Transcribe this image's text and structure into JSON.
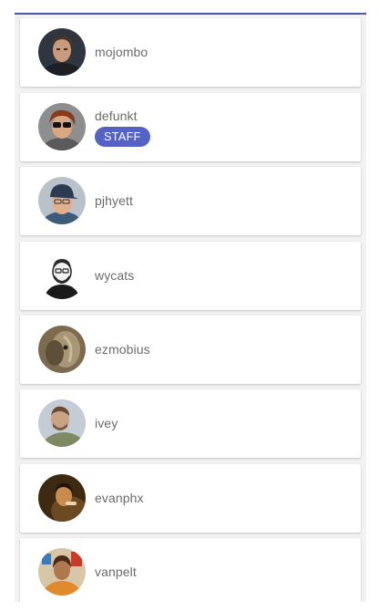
{
  "users": [
    {
      "login": "mojombo"
    },
    {
      "login": "defunkt",
      "badge": "STAFF"
    },
    {
      "login": "pjhyett"
    },
    {
      "login": "wycats"
    },
    {
      "login": "ezmobius"
    },
    {
      "login": "ivey"
    },
    {
      "login": "evanphx"
    },
    {
      "login": "vanpelt"
    }
  ],
  "colors": {
    "accent_line": "#4b55a6",
    "badge_bg": "#5564c4",
    "username_text": "#6b6b6b"
  },
  "icons": [
    "avatar-mojombo",
    "avatar-defunkt",
    "avatar-pjhyett",
    "avatar-wycats",
    "avatar-ezmobius",
    "avatar-ivey",
    "avatar-evanphx",
    "avatar-vanpelt"
  ]
}
